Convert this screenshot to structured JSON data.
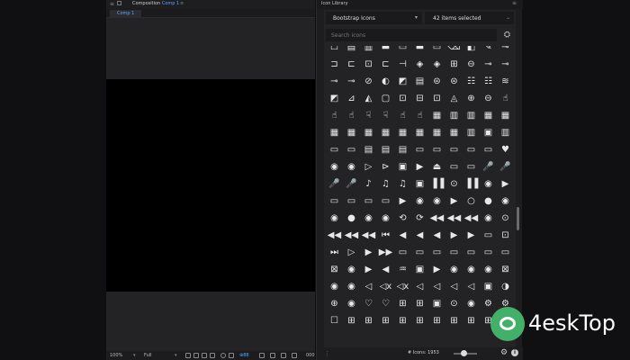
{
  "composition": {
    "panel_title": "Composition",
    "comp_name": "Comp 1",
    "tab_label": "Comp 1",
    "zoom": "100%",
    "resolution": "Full",
    "hex_label": "⊕88",
    "timecode": "000"
  },
  "icon_library": {
    "title": "Icon Library",
    "icon_set": "Bootstrap Icons",
    "selection_count": "42 items selected",
    "search_placeholder": "Search icons",
    "icon_count": "# Icons: 1953"
  },
  "watermark": {
    "brand": "4eskTop"
  },
  "icon_grid": {
    "rows": [
      [
        "☐",
        "▤",
        "▥",
        "▬",
        "▭",
        "▬",
        "▭",
        "⌫",
        "◧",
        "✎",
        "⊸"
      ],
      [
        "⊐",
        "⊏",
        "⊡",
        "⊏",
        "⊣",
        "◈",
        "◈",
        "⊞",
        "⊖",
        "⊸",
        "⊸"
      ],
      [
        "⊸",
        "⊸",
        "⊘",
        "◐",
        "◩",
        "▤",
        "⊜",
        "⊜",
        "☷",
        "☷",
        "≋"
      ],
      [
        "◩",
        "⊿",
        "◭",
        "▢",
        "⊡",
        "⊟",
        "⊡",
        "◬",
        "⊕",
        "⊖",
        "☝"
      ],
      [
        "☝",
        "☝",
        "☟",
        "☟",
        "☝",
        "☝",
        "▦",
        "▥",
        "▥",
        "▦",
        "▦"
      ],
      [
        "▦",
        "▦",
        "▦",
        "▦",
        "▦",
        "▦",
        "▦",
        "▦",
        "▥",
        "▣",
        "▥"
      ],
      [
        "▭",
        "▭",
        "▤",
        "▤",
        "▤",
        "▭",
        "▭",
        "▭",
        "▭",
        "▭",
        "♥"
      ],
      [
        "◉",
        "◉",
        "▷",
        "⊳",
        "▣",
        "▶",
        "⏏",
        "▭",
        "▭",
        "🎤",
        "🎤"
      ],
      [
        "🎤",
        "🎤",
        "♪",
        "♫",
        "♫",
        "▣",
        "▐▐",
        "⊙",
        "▐▐",
        "◉",
        "▶"
      ],
      [
        "▭",
        "▭",
        "▭",
        "▭",
        "▶",
        "◉",
        "◉",
        "▶",
        "○",
        "●",
        "◉"
      ],
      [
        "◉",
        "●",
        "◉",
        "◉",
        "⟲",
        "⟳",
        "◀◀",
        "◀◀",
        "◀◀",
        "◉",
        "⊙"
      ],
      [
        "◀◀",
        "◀◀",
        "◀◀",
        "⏮",
        "◀",
        "◀",
        "◀",
        "▶",
        "▶",
        "▭",
        "⊡"
      ],
      [
        "⏭",
        "▷",
        "▶",
        "▶▶",
        "▭",
        "▭",
        "▭",
        "▭",
        "▭",
        "▭",
        "▭"
      ],
      [
        "⊠",
        "◉",
        "▶",
        "◀",
        "♒",
        "▣",
        "▶",
        "◉",
        "◉",
        "◉",
        "⊠"
      ],
      [
        "◉",
        "◉",
        "◁",
        "◁x",
        "◁x",
        "◁",
        "◁",
        "◁",
        "◁",
        "▣",
        "◑"
      ],
      [
        "⊕",
        "◉",
        "♡",
        "♡",
        "⊞",
        "⊞",
        "▣",
        "⊙",
        "◉",
        "⚙",
        "⚙"
      ],
      [
        "☐",
        "⊞",
        "⊞",
        "⊞",
        "⊞",
        "⊞",
        "⊞",
        "⊞",
        "⊞",
        "⊞",
        "⊞"
      ]
    ]
  }
}
